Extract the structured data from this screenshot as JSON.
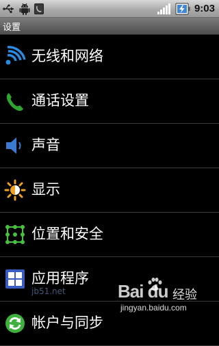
{
  "status_bar": {
    "time": "9:03",
    "icons": [
      "usb-icon",
      "android-debug-icon",
      "notification-icon",
      "signal-icon",
      "battery-charging-icon"
    ]
  },
  "title_bar": {
    "title": "设置"
  },
  "settings": {
    "items": [
      {
        "label": "无线和网络",
        "icon": "wifi-icon",
        "color": "#2b8be0"
      },
      {
        "label": "通话设置",
        "icon": "phone-icon",
        "color": "#2ea52e"
      },
      {
        "label": "声音",
        "icon": "speaker-icon",
        "color": "#3a7ad0"
      },
      {
        "label": "显示",
        "icon": "brightness-icon",
        "color": "#f0a020"
      },
      {
        "label": "位置和安全",
        "icon": "lock-pattern-icon",
        "color": "#4ac040"
      },
      {
        "label": "应用程序",
        "icon": "applications-icon",
        "color": "#3a5cc0"
      },
      {
        "label": "帐户与同步",
        "icon": "sync-icon",
        "color": "#3db03d"
      }
    ]
  },
  "watermark": {
    "site": "jb51.net",
    "brand": "Bai du",
    "jingyan": "经验",
    "url": "jingyan.baidu.com"
  }
}
